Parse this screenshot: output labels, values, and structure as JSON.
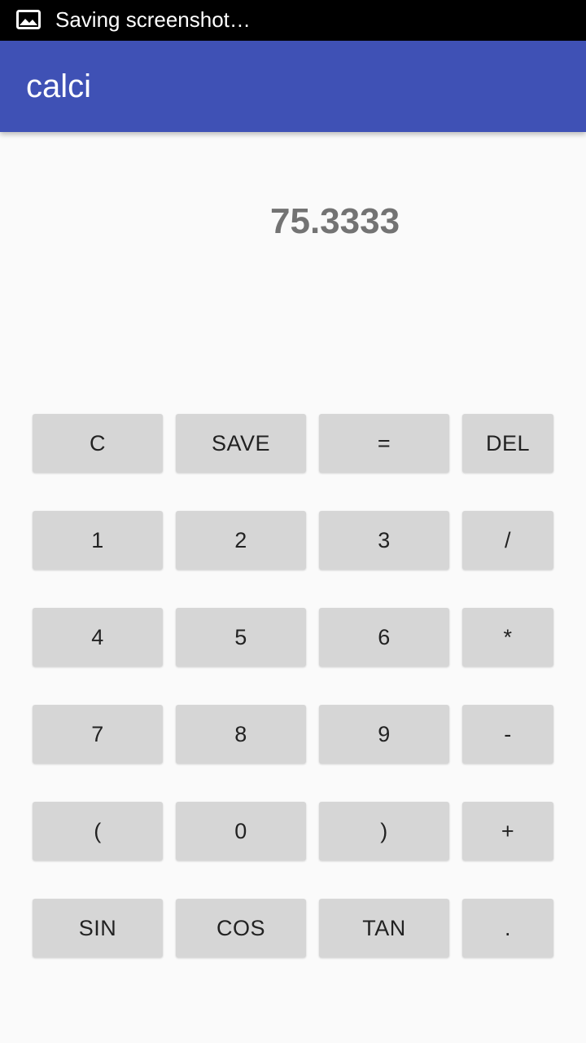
{
  "status_bar": {
    "icon": "image-icon",
    "text": "Saving screenshot…"
  },
  "app_bar": {
    "title": "calci"
  },
  "display": {
    "value": "75.3333"
  },
  "keypad": {
    "rows": [
      [
        "C",
        "SAVE",
        "=",
        "DEL"
      ],
      [
        "1",
        "2",
        "3",
        "/"
      ],
      [
        "4",
        "5",
        "6",
        "*"
      ],
      [
        "7",
        "8",
        "9",
        "-"
      ],
      [
        "(",
        "0",
        ")",
        "+"
      ],
      [
        "SIN",
        "COS",
        "TAN",
        "."
      ]
    ]
  },
  "colors": {
    "app_bar": "#3f51b5",
    "status_bar": "#000000",
    "background": "#fafafa",
    "key": "#d6d6d6",
    "display_text": "#737373"
  }
}
